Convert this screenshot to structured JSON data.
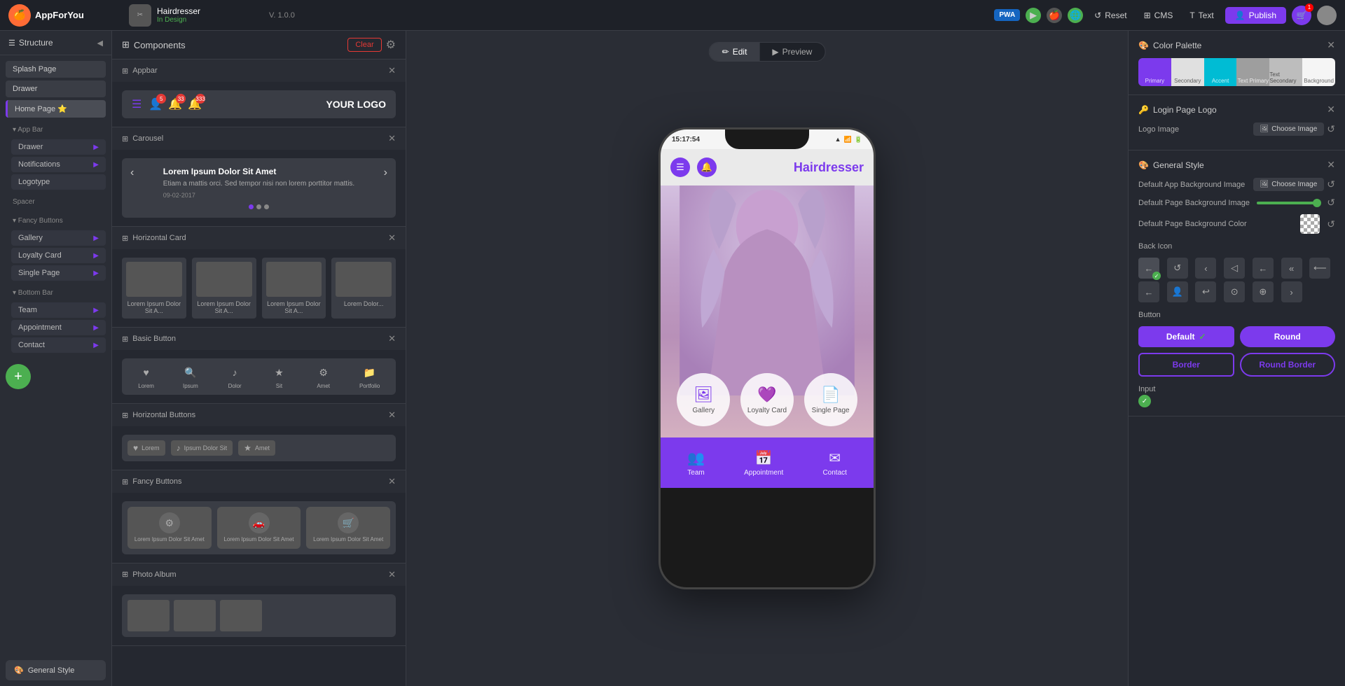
{
  "app": {
    "name": "AppForYou",
    "project": "Hairdresser",
    "status": "In Design",
    "version": "V. 1.0.0"
  },
  "topbar": {
    "pwa_label": "PWA",
    "reset_label": "Reset",
    "cms_label": "CMS",
    "text_label": "Text",
    "publish_label": "Publish",
    "cart_count": "1"
  },
  "left_panel": {
    "title": "Structure",
    "items": [
      {
        "label": "Splash Page"
      },
      {
        "label": "Drawer"
      },
      {
        "label": "Home Page"
      }
    ],
    "sections": [
      {
        "name": "App Bar",
        "items": [
          {
            "label": "Drawer"
          },
          {
            "label": "Notifications"
          },
          {
            "label": "Logotype"
          }
        ]
      },
      {
        "name": "Spacer",
        "items": []
      },
      {
        "name": "Fancy Buttons",
        "items": [
          {
            "label": "Gallery"
          },
          {
            "label": "Loyalty Card"
          },
          {
            "label": "Single Page"
          }
        ]
      },
      {
        "name": "Bottom Bar",
        "items": [
          {
            "label": "Team"
          },
          {
            "label": "Appointment"
          },
          {
            "label": "Contact"
          }
        ]
      }
    ],
    "general_style_btn": "General Style"
  },
  "mid_panel": {
    "title": "Components",
    "clear_btn": "Clear",
    "sections": [
      {
        "name": "Appbar",
        "badges": [
          "5",
          "33",
          "333"
        ]
      },
      {
        "name": "Carousel",
        "title": "Lorem Ipsum Dolor Sit Amet",
        "body": "Etiam a mattis orci. Sed tempor nisi non lorem porttitor mattis.",
        "date": "09-02-2017"
      },
      {
        "name": "Horizontal Card",
        "items": [
          {
            "label": "Lorem Ipsum Dolor Sit A..."
          },
          {
            "label": "Lorem Ipsum Dolor Sit A..."
          },
          {
            "label": "Lorem Ipsum Dolor Sit A..."
          },
          {
            "label": "Lorem Dolor..."
          }
        ]
      },
      {
        "name": "Basic Button",
        "items": [
          {
            "icon": "♥",
            "label": "Lorem"
          },
          {
            "icon": "🔍",
            "label": "Ipsum"
          },
          {
            "icon": "♪",
            "label": "Dolor"
          },
          {
            "icon": "★",
            "label": "Sit"
          },
          {
            "icon": "⚙",
            "label": "Amet"
          },
          {
            "icon": "📁",
            "label": "Portfolio"
          }
        ]
      },
      {
        "name": "Horizontal Buttons",
        "items": [
          {
            "icon": "♥",
            "label": "Lorem"
          },
          {
            "icon": "♪",
            "label": "Ipsum Dolor Sit"
          },
          {
            "icon": "★",
            "label": "Amet"
          }
        ]
      },
      {
        "name": "Fancy Buttons",
        "items": [
          {
            "icon": "⚙",
            "label": "Lorem Ipsum Dolor Sit Amet"
          },
          {
            "icon": "🚗",
            "label": "Lorem Ipsum Dolor Sit Amet"
          },
          {
            "icon": "🛒",
            "label": "Lorem Ipsum Dolor Sit Amet"
          }
        ]
      },
      {
        "name": "Photo Album"
      }
    ]
  },
  "phone": {
    "time": "15:17:54",
    "title": "Hairdresser",
    "edit_tab": "Edit",
    "preview_tab": "Preview",
    "fancy_btns": [
      {
        "icon": "🖼",
        "label": "Gallery"
      },
      {
        "icon": "💜",
        "label": "Loyalty Card"
      },
      {
        "icon": "📄",
        "label": "Single Page"
      }
    ],
    "bottom_bar": [
      {
        "icon": "👥",
        "label": "Team"
      },
      {
        "icon": "📅",
        "label": "Appointment"
      },
      {
        "icon": "✉",
        "label": "Contact"
      }
    ]
  },
  "right_panel": {
    "color_palette": {
      "title": "Color Palette",
      "swatches": [
        {
          "color": "#7c3aed",
          "label": "Primary",
          "dark": false
        },
        {
          "color": "#e0e0e0",
          "label": "Secondary",
          "dark": true
        },
        {
          "color": "#00bcd4",
          "label": "Accent",
          "dark": false
        },
        {
          "color": "#9e9e9e",
          "label": "Text Primary",
          "dark": false
        },
        {
          "color": "#bdbdbd",
          "label": "Text Secondary",
          "dark": true
        },
        {
          "color": "#f5f5f5",
          "label": "Background",
          "dark": true
        }
      ]
    },
    "login_page_logo": {
      "title": "Login Page Logo",
      "logo_image_label": "Logo Image",
      "choose_btn": "Choose Image"
    },
    "general_style": {
      "title": "General Style",
      "bg_image_label": "Default App Background Image",
      "choose_btn_1": "Choose Image",
      "page_bg_image_label": "Default Page Background Image",
      "page_bg_color_label": "Default Page Background Color",
      "back_icon_label": "Back Icon",
      "button_label": "Button",
      "btn_default": "Default",
      "btn_round": "Round",
      "btn_border": "Border",
      "btn_round_border": "Round Border",
      "input_label": "Input"
    }
  }
}
